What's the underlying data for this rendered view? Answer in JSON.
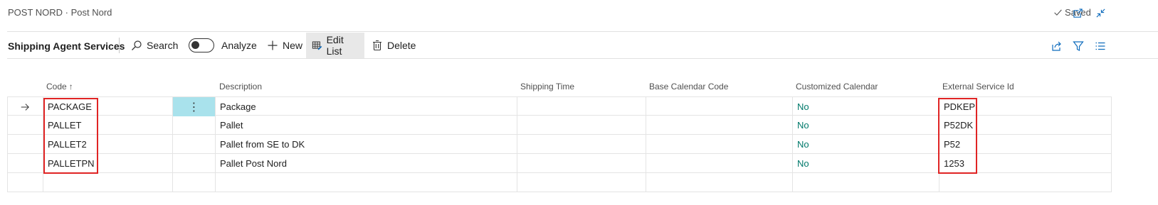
{
  "titlebar": {
    "title": "POST NORD · Post Nord",
    "saved": "Saved"
  },
  "actionbar": {
    "caption": "Shipping Agent Services",
    "search": "Search",
    "analyze": "Analyze",
    "new": "New",
    "edit_list": "Edit List",
    "delete": "Delete"
  },
  "grid": {
    "headers": {
      "code": "Code",
      "code_sort": "↑",
      "description": "Description",
      "shipping_time": "Shipping Time",
      "base_calendar_code": "Base Calendar Code",
      "customized_calendar": "Customized Calendar",
      "external_service_id": "External Service Id"
    },
    "rows": [
      {
        "code": "PACKAGE",
        "description": "Package",
        "shipping_time": "",
        "base_calendar_code": "",
        "customized_calendar": "No",
        "external_service_id": "PDKEP"
      },
      {
        "code": "PALLET",
        "description": "Pallet",
        "shipping_time": "",
        "base_calendar_code": "",
        "customized_calendar": "No",
        "external_service_id": "P52DK"
      },
      {
        "code": "PALLET2",
        "description": "Pallet from SE to DK",
        "shipping_time": "",
        "base_calendar_code": "",
        "customized_calendar": "No",
        "external_service_id": "P52"
      },
      {
        "code": "PALLETPN",
        "description": "Pallet Post Nord",
        "shipping_time": "",
        "base_calendar_code": "",
        "customized_calendar": "No",
        "external_service_id": "1253"
      }
    ],
    "row_action_glyph": "⋮"
  },
  "colors": {
    "link": "#00796b",
    "selected_cell": "#a9e2ec",
    "highlight": "#e02424"
  }
}
